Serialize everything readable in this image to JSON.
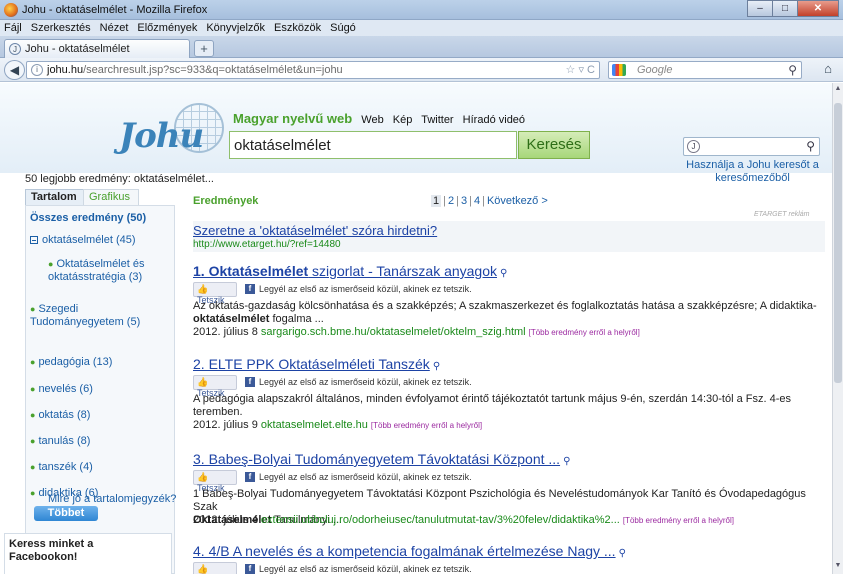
{
  "window": {
    "title": "Johu - oktatáselmélet - Mozilla Firefox"
  },
  "menu": [
    "Fájl",
    "Szerkesztés",
    "Nézet",
    "Előzmények",
    "Könyvjelzők",
    "Eszközök",
    "Súgó"
  ],
  "tab": {
    "label": "Johu - oktatáselmélet"
  },
  "address": {
    "host": "johu.hu",
    "rest": "/searchresult.jsp?sc=933&q=oktatáselmélet&un=johu"
  },
  "browser_search": {
    "placeholder": "Google"
  },
  "site": {
    "logo": "Johu",
    "tagline": "Magyar nyelvű web",
    "nav": [
      "Web",
      "Kép",
      "Twitter",
      "Híradó videó"
    ],
    "query": "oktatáselmélet",
    "search_button": "Keresés",
    "side_help": "Használja a Johu keresőt a keresőmezőből"
  },
  "count_text": "50 legjobb eredmény: oktatáselmélet...",
  "left": {
    "tab_active": "Tartalom",
    "tab_inactive": "Grafikus",
    "all_results": "Összes eredmény (50)",
    "items": [
      "oktatáselmélet (45)",
      "Oktatáselmélet és oktatásstratégia (3)",
      "Szegedi Tudományegyetem (5)",
      "pedagógia (13)",
      "nevelés (6)",
      "oktatás (8)",
      "tanulás (8)",
      "tanszék (4)",
      "didaktika (6)"
    ],
    "more_button": "Többet",
    "toc_question": "Mire jó a tartalomjegyzék?",
    "fb_box": "Keress minket a Facebookon!"
  },
  "results_header": "Eredmények",
  "pager": {
    "pages": [
      "1",
      "2",
      "3",
      "4"
    ],
    "next": "Következő >"
  },
  "ad": {
    "tag": "ETARGET reklám",
    "title": "Szeretne a 'oktatáselmélet' szóra hirdetni?",
    "url": "http://www.etarget.hu/?ref=14480"
  },
  "like": {
    "button": "Tetszik",
    "text": "Legyél az első az ismerőseid közül, akinek ez tetszik."
  },
  "more_from_site": "[Több eredmény erről a helyről]",
  "results": [
    {
      "title_bold": "1. Oktatáselmélet",
      "title_rest": " szigorlat - Tanárszak anyagok",
      "snippet": "Az oktatás-gazdaság kölcsönhatása és a szakképzés; A szakmaszerkezet és foglalkoztatás hatása a szakképzésre; A didaktika-",
      "snippet_bold": "oktatáselmélet",
      "snippet_tail": " fogalma ...",
      "date": "2012. július 8",
      "url": "sargarigo.sch.bme.hu/oktataselmelet/oktelm_szig.html"
    },
    {
      "title_bold": "",
      "title_rest": "2. ELTE PPK Oktatáselméleti Tanszék",
      "snippet": "A pedagógia alapszakról általános, minden évfolyamot érintő tájékoztatót tartunk május 9-én, szerdán 14:30-tól a Fsz. 4-es teremben.",
      "snippet_bold": "",
      "snippet_tail": "",
      "date": "2012. július 9",
      "url": "oktataselmelet.elte.hu"
    },
    {
      "title_bold": "",
      "title_rest": "3. Babeş-Bolyai Tudományegyetem Távoktatási Központ ...",
      "snippet": "1 Babeş-Bolyai Tudományegyetem Távoktatási Központ Pszichológia és Neveléstudományok Kar Tanító és Óvodapedagógus Szak",
      "snippet_bold": "Oktatáselmélet",
      "snippet_tail": " Tanulmányi ...",
      "date": "2012. július 4",
      "url": "extensii.ubbcluj.ro/odorheiusec/tanulutmutat-tav/3%20felev/didaktika%2..."
    },
    {
      "title_bold": "",
      "title_rest": "4. 4/B A nevelés és a kompetencia fogalmának értelmezése Nagy ...",
      "snippet": "",
      "snippet_bold": "",
      "snippet_tail": "",
      "date": "",
      "url": ""
    }
  ]
}
